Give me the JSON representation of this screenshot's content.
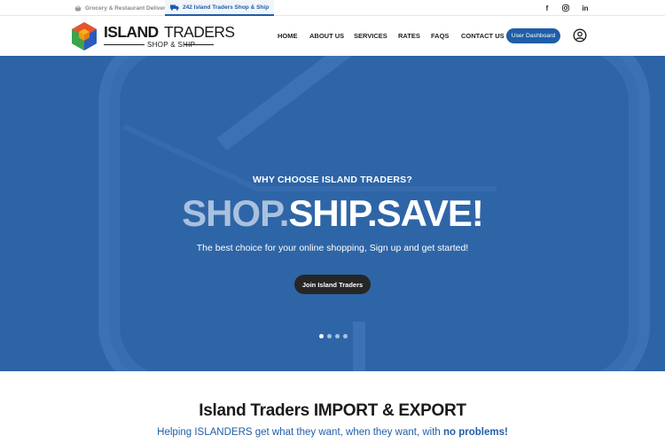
{
  "topbar": {
    "tabs": [
      {
        "label": "Grocery & Restaurant Delivery",
        "icon": "basket-icon",
        "active": false
      },
      {
        "label": "242 Island Traders Shop & Ship",
        "icon": "truck-icon",
        "active": true
      }
    ],
    "social": [
      {
        "icon": "facebook-icon",
        "glyph": "f"
      },
      {
        "icon": "instagram-icon",
        "glyph": ""
      },
      {
        "icon": "linkedin-icon",
        "glyph": "in"
      }
    ]
  },
  "header": {
    "logo": {
      "brand_bold": "ISLAND",
      "brand_light": "TRADERS",
      "tagline": "SHOP & SHIP"
    },
    "nav": [
      "HOME",
      "ABOUT US",
      "SERVICES",
      "RATES",
      "FAQS",
      "CONTACT US"
    ],
    "dashboard_button": "User Dashboard",
    "account_icon": "user-circle-icon"
  },
  "hero": {
    "kicker": "WHY CHOOSE ISLAND TRADERS?",
    "headline": {
      "part1": "SHOP.",
      "part2": "SHIP.",
      "part3": "SAVE!"
    },
    "subtitle": "The best choice for your online shopping, Sign up and get started!",
    "cta": "Join Island Traders",
    "slides_total": 4,
    "slide_active": 1
  },
  "section": {
    "title": "Island Traders IMPORT & EXPORT",
    "subtitle_lead": "Helping ISLANDERS get what they want, when they want, with",
    "subtitle_emphasis": "no problems!"
  },
  "colors": {
    "brand_blue": "#1f5ea8",
    "hero_bg": "#2d64a6",
    "hero_accent": "#a9c1df",
    "cta_bg": "#262626"
  }
}
